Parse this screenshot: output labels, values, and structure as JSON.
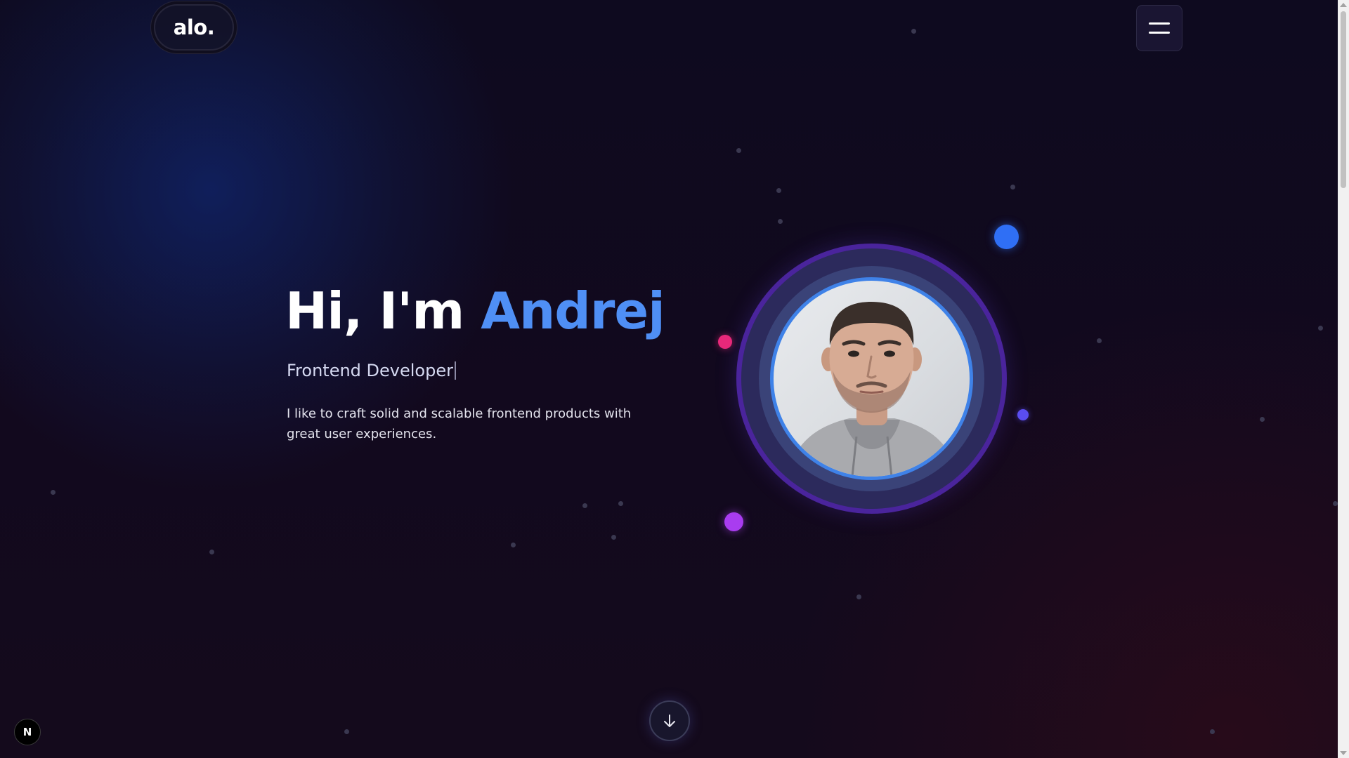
{
  "header": {
    "logo_text": "alo.",
    "menu_icon": "hamburger-menu-icon"
  },
  "hero": {
    "greeting": "Hi, I'm",
    "name": "Andrej",
    "role": "Frontend Developer",
    "bio": "I like to craft solid and scalable frontend products with great user experiences."
  },
  "avatar": {
    "alt": "Andrej"
  },
  "scroll_button": {
    "icon": "arrow-down-icon"
  },
  "dev_badge": {
    "letter": "N"
  },
  "colors": {
    "accent": "#4f8ff5",
    "orb_blue": "#2f6ff5",
    "orb_pink": "#e8287a",
    "orb_violet": "#5a4df0",
    "orb_purple": "#a93cf0"
  }
}
